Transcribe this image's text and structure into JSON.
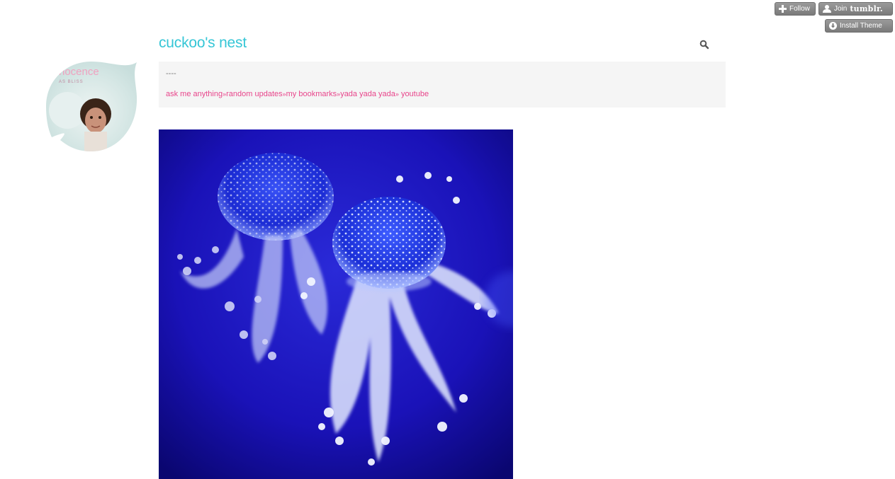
{
  "tumblr_controls": {
    "follow_label": "Follow",
    "join_label": "Join",
    "join_brand": "tumblr.",
    "install_label": "Install Theme"
  },
  "avatar": {
    "caption_line1": "nocence",
    "caption_line2": "AS BLISS"
  },
  "header": {
    "blog_title": "cuckoo's nest"
  },
  "description": {
    "text": "----"
  },
  "nav": {
    "links": [
      "ask me anything",
      "random updates",
      "my bookmarks",
      "yada yada yada",
      "youtube"
    ],
    "separator": "»"
  },
  "colors": {
    "title": "#35c6d6",
    "link": "#e8458b",
    "desc_bg": "#f5f5f5"
  },
  "icons": {
    "search": "search-icon",
    "follow": "plus-icon",
    "join": "person-icon",
    "install": "download-icon"
  }
}
